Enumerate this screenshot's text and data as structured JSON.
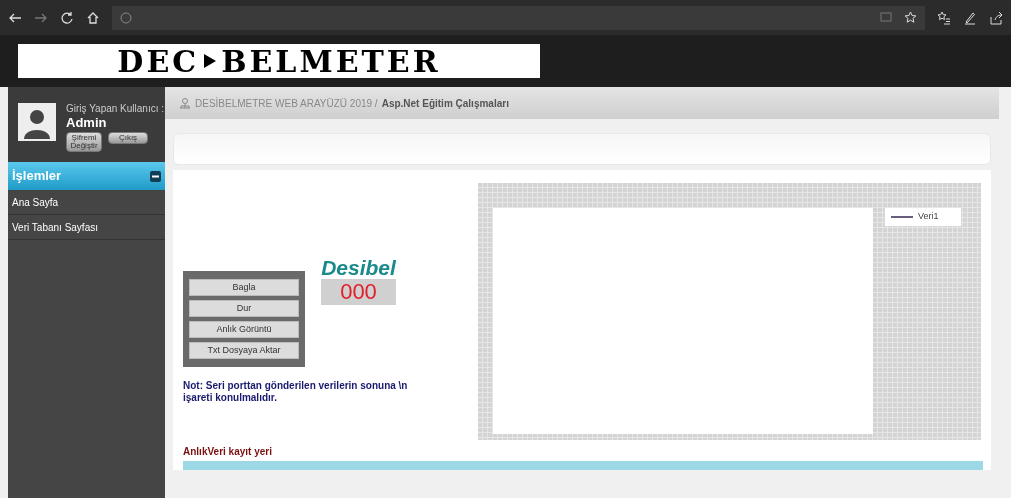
{
  "logo": {
    "left": "DEC",
    "right": "BELMETER"
  },
  "user": {
    "caption": "Giriş Yapan Kullanıcı :",
    "name": "Admin",
    "buttons": [
      "Şifremi Değiştir",
      "Çıkış"
    ]
  },
  "menu": {
    "title": "İşlemler",
    "expanded": true,
    "items": [
      {
        "label": "Ana Sayfa",
        "selected": false
      },
      {
        "label": "Veri Tabanı Sayfası",
        "selected": false
      }
    ]
  },
  "breadcrumb": {
    "site": "DESİBELMETRE WEB ARAYÜZÜ 2019 /",
    "page": "Asp.Net Eğitim Çalışmaları"
  },
  "controls": {
    "buttons": [
      "Bagla",
      "Dur",
      "Anlık Görüntü",
      "Txt Dosyaya Aktar"
    ],
    "meter_label": "Desibel",
    "meter_value": "000",
    "note": "Not: Seri porttan gönderilen verilerin sonuna \\n işareti konulmalıdır."
  },
  "chart": {
    "legend": "Veri1"
  },
  "log": {
    "label": "AnlıkVeri kayıt yeri"
  }
}
